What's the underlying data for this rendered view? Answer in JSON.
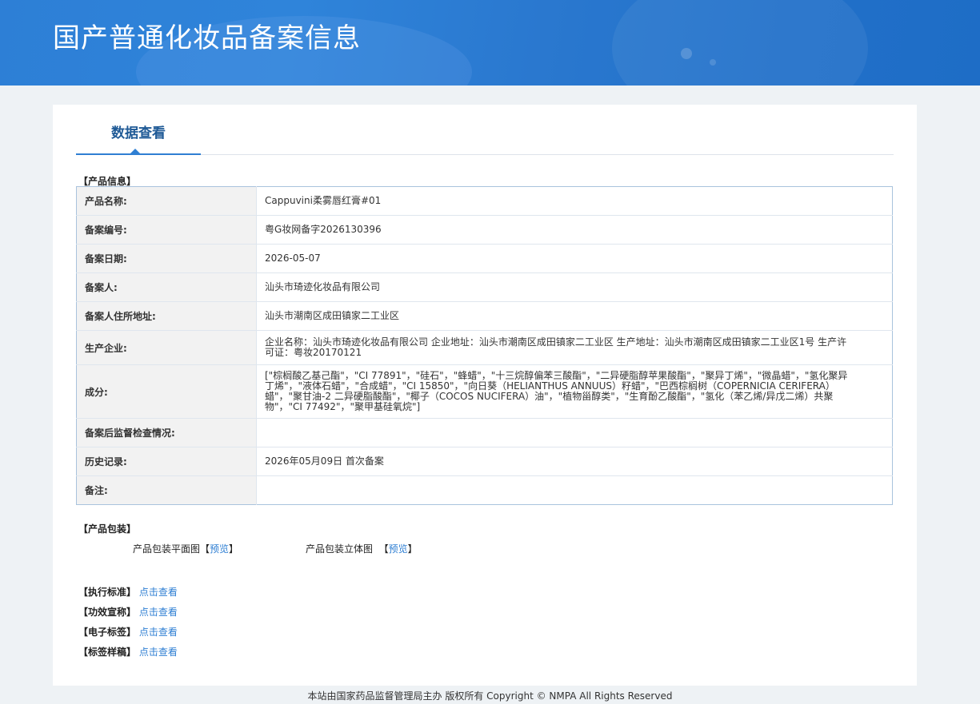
{
  "header": {
    "title": "国产普通化妆品备案信息"
  },
  "tabs": {
    "active": "数据查看"
  },
  "product_info": {
    "section_title": "【产品信息】",
    "rows": [
      {
        "key": "产品名称:",
        "value": "Cappuvini柔雾唇红膏#01"
      },
      {
        "key": "备案编号:",
        "value": "粤G妆网备字2026130396"
      },
      {
        "key": "备案日期:",
        "value": "2026-05-07"
      },
      {
        "key": "备案人:",
        "value": "汕头市琦迹化妆品有限公司"
      },
      {
        "key": "备案人住所地址:",
        "value": "汕头市潮南区成田镇家二工业区"
      },
      {
        "key": "生产企业:",
        "value": "企业名称：汕头市琦迹化妆品有限公司 企业地址：汕头市潮南区成田镇家二工业区 生产地址：汕头市潮南区成田镇家二工业区1号 生产许可证：粤妆20170121"
      },
      {
        "key": "成分:",
        "value": "[\"棕榈酸乙基己酯\"，\"CI 77891\"，\"硅石\"，\"蜂蜡\"，\"十三烷醇偏苯三酸酯\"，\"二异硬脂醇苹果酸酯\"，\"聚异丁烯\"，\"微晶蜡\"，\"氢化聚异丁烯\"，\"液体石蜡\"，\"合成蜡\"，\"CI 15850\"，\"向日葵（HELIANTHUS ANNUUS）籽蜡\"，\"巴西棕榈树（COPERNICIA CERIFERA）蜡\"，\"聚甘油-2 二异硬脂酸酯\"，\"椰子（COCOS NUCIFERA）油\"，\"植物甾醇类\"，\"生育酚乙酸酯\"，\"氢化（苯乙烯/异戊二烯）共聚物\"，\"CI 77492\"，\"聚甲基硅氧烷\"]"
      },
      {
        "key": "备案后监督检查情况:",
        "value": ""
      },
      {
        "key": "历史记录:",
        "value": "2026年05月09日 首次备案"
      },
      {
        "key": "备注:",
        "value": ""
      }
    ]
  },
  "packaging": {
    "section_title": "【产品包装】",
    "flat_label": "产品包装平面图",
    "stereo_label": "产品包装立体图",
    "preview_label": "预览"
  },
  "extras": [
    {
      "label": "【执行标准】",
      "link": "点击查看"
    },
    {
      "label": "【功效宣称】",
      "link": "点击查看"
    },
    {
      "label": "【电子标签】",
      "link": "点击查看"
    },
    {
      "label": "【标签样稿】",
      "link": "点击查看"
    }
  ],
  "footer": {
    "text": "本站由国家药品监督管理局主办 版权所有 Copyright © NMPA All Rights Reserved"
  }
}
